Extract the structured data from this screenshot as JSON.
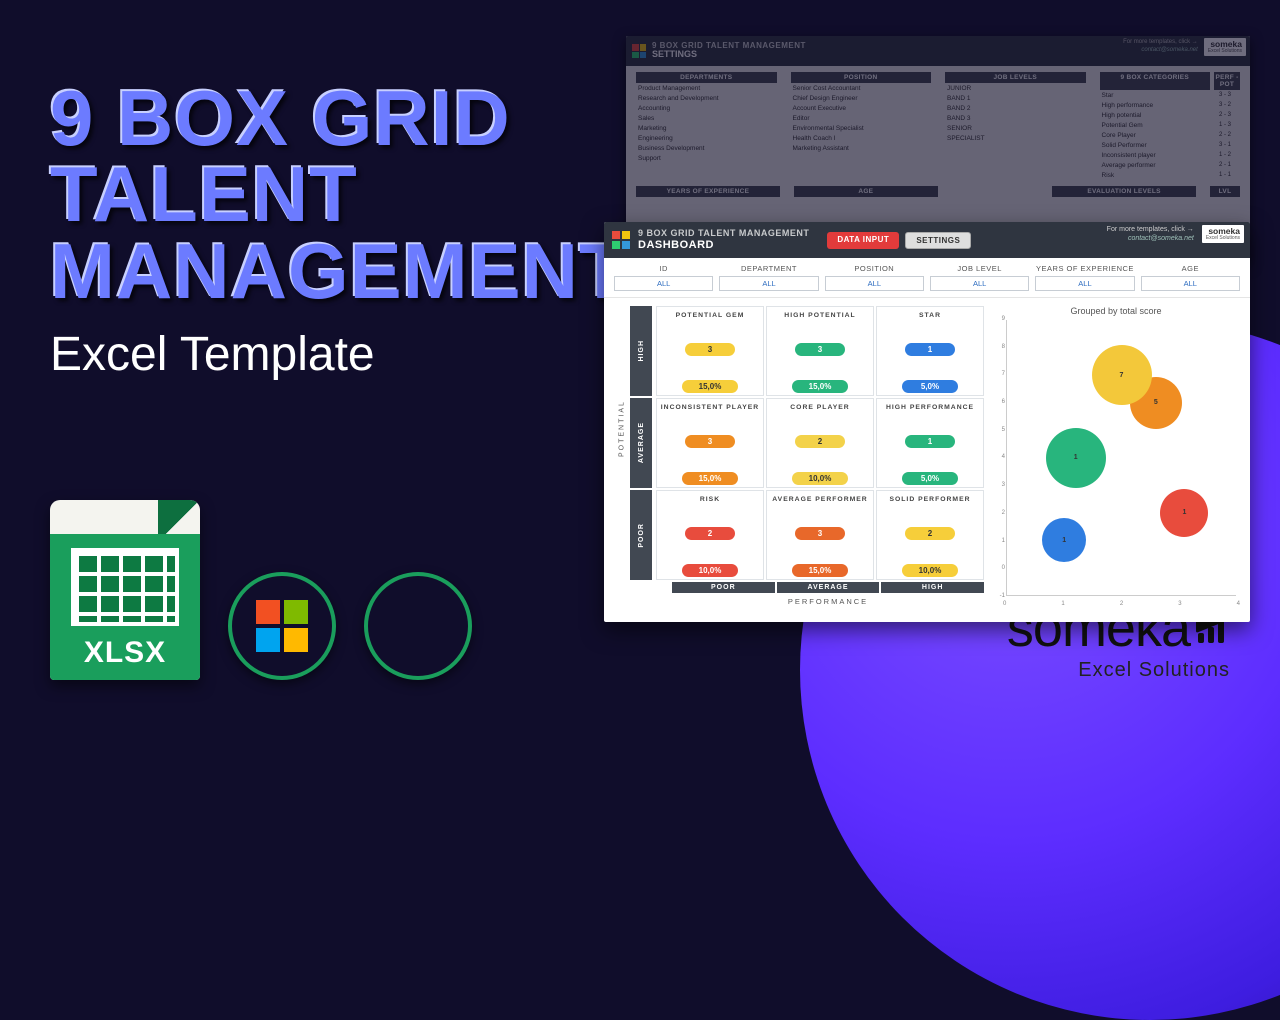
{
  "headline": {
    "line1": "9 BOX GRID",
    "line2": "TALENT",
    "line3": "MANAGEMENT",
    "sub": "Excel Template"
  },
  "xlsx_label": "XLSX",
  "someka": {
    "brand": "someka",
    "tag": "Excel Solutions"
  },
  "settings_panel": {
    "app_title": "9 BOX GRID TALENT MANAGEMENT",
    "page_title": "SETTINGS",
    "more_link": "For more templates, click →",
    "contact": "contact@someka.net",
    "columns": {
      "departments": {
        "head": "DEPARTMENTS",
        "items": [
          "Product Management",
          "Research and Development",
          "Accounting",
          "Sales",
          "Marketing",
          "Engineering",
          "Business Development",
          "Support"
        ]
      },
      "position": {
        "head": "POSITION",
        "items": [
          "Senior Cost Accountant",
          "Chief Design Engineer",
          "Account Executive",
          "Editor",
          "Environmental Specialist",
          "Health Coach I",
          "Marketing Assistant"
        ]
      },
      "joblevels": {
        "head": "JOB LEVELS",
        "items": [
          "JUNIOR",
          "BAND 1",
          "BAND 2",
          "BAND 3",
          "SENIOR",
          "SPECIALIST"
        ]
      },
      "categories": {
        "head": "9 BOX CATEGORIES",
        "pp_head": "PERF - POT",
        "items": [
          {
            "n": "Star",
            "v": "3 - 3"
          },
          {
            "n": "High performance",
            "v": "3 - 2"
          },
          {
            "n": "High potential",
            "v": "2 - 3"
          },
          {
            "n": "Potential Gem",
            "v": "1 - 3"
          },
          {
            "n": "Core Player",
            "v": "2 - 2"
          },
          {
            "n": "Solid Performer",
            "v": "3 - 1"
          },
          {
            "n": "Inconsistent player",
            "v": "1 - 2"
          },
          {
            "n": "Average performer",
            "v": "2 - 1"
          },
          {
            "n": "Risk",
            "v": "1 - 1"
          }
        ]
      }
    },
    "footer": {
      "exp": "YEARS OF EXPERIENCE",
      "age": "AGE",
      "eval": "EVALUATION LEVELS",
      "lvl": "LVL"
    }
  },
  "dashboard": {
    "app_title": "9 BOX GRID TALENT MANAGEMENT",
    "page_title": "DASHBOARD",
    "btn_data": "DATA INPUT",
    "btn_settings": "SETTINGS",
    "more_link": "For more templates, click →",
    "contact": "contact@someka.net",
    "filters": [
      {
        "lbl": "ID",
        "val": "ALL"
      },
      {
        "lbl": "DEPARTMENT",
        "val": "ALL"
      },
      {
        "lbl": "POSITION",
        "val": "ALL"
      },
      {
        "lbl": "JOB LEVEL",
        "val": "ALL"
      },
      {
        "lbl": "YEARS OF EXPERIENCE",
        "val": "ALL"
      },
      {
        "lbl": "AGE",
        "val": "ALL"
      }
    ],
    "axis": {
      "potential": "POTENTIAL",
      "performance": "PERFORMANCE",
      "pot_bands": [
        "HIGH",
        "AVERAGE",
        "POOR"
      ],
      "perf_bands": [
        "POOR",
        "AVERAGE",
        "HIGH"
      ]
    },
    "cells": [
      [
        {
          "name": "POTENTIAL GEM",
          "count": "3",
          "pct": "15,0%",
          "color": "c-yellow"
        },
        {
          "name": "HIGH POTENTIAL",
          "count": "3",
          "pct": "15,0%",
          "color": "c-green"
        },
        {
          "name": "STAR",
          "count": "1",
          "pct": "5,0%",
          "color": "c-blue"
        }
      ],
      [
        {
          "name": "INCONSISTENT PLAYER",
          "count": "3",
          "pct": "15,0%",
          "color": "c-orange"
        },
        {
          "name": "CORE PLAYER",
          "count": "2",
          "pct": "10,0%",
          "color": "c-lyellow"
        },
        {
          "name": "HIGH PERFORMANCE",
          "count": "1",
          "pct": "5,0%",
          "color": "c-green"
        }
      ],
      [
        {
          "name": "RISK",
          "count": "2",
          "pct": "10,0%",
          "color": "c-red"
        },
        {
          "name": "AVERAGE PERFORMER",
          "count": "3",
          "pct": "15,0%",
          "color": "c-dorange"
        },
        {
          "name": "SOLID PERFORMER",
          "count": "2",
          "pct": "10,0%",
          "color": "c-yellow"
        }
      ]
    ],
    "chart_data": {
      "type": "scatter",
      "title": "Grouped by total score",
      "xlim": [
        0,
        4
      ],
      "ylim": [
        -1,
        9
      ],
      "yticks": [
        "9",
        "8",
        "7",
        "6",
        "5",
        "4",
        "3",
        "2",
        "1",
        "0",
        "-1"
      ],
      "xticks": [
        "0",
        "1",
        "2",
        "3",
        "4"
      ],
      "points": [
        {
          "x": 1.0,
          "y": 1.0,
          "r": 22,
          "label": "1",
          "color": "#2f7de0"
        },
        {
          "x": 3.1,
          "y": 2.0,
          "r": 24,
          "label": "1",
          "color": "#e84c3d"
        },
        {
          "x": 1.2,
          "y": 4.0,
          "r": 30,
          "label": "1",
          "color": "#28b57d"
        },
        {
          "x": 2.6,
          "y": 6.0,
          "r": 26,
          "label": "5",
          "color": "#ef8d22"
        },
        {
          "x": 2.0,
          "y": 7.0,
          "r": 30,
          "label": "7",
          "color": "#f3c83a"
        }
      ]
    }
  }
}
